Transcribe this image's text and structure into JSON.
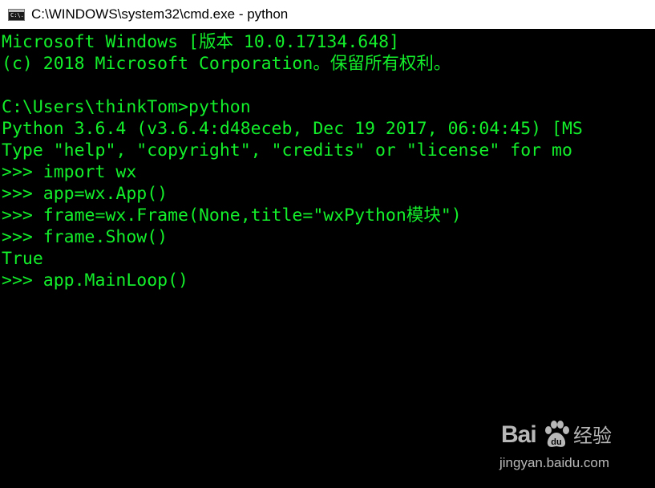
{
  "window": {
    "title": "C:\\WINDOWS\\system32\\cmd.exe - python",
    "icon": "cmd-icon",
    "icon_glyph": "C:\\."
  },
  "colors": {
    "console_background": "#000000",
    "console_text": "#13ef2a",
    "titlebar_background": "#ffffff"
  },
  "console": {
    "lines": [
      "Microsoft Windows [版本 10.0.17134.648]",
      "(c) 2018 Microsoft Corporation。保留所有权利。",
      "",
      "C:\\Users\\thinkTom>python",
      "Python 3.6.4 (v3.6.4:d48eceb, Dec 19 2017, 06:04:45) [MS",
      "Type \"help\", \"copyright\", \"credits\" or \"license\" for mo",
      ">>> import wx",
      ">>> app=wx.App()",
      ">>> frame=wx.Frame(None,title=\"wxPython模块\")",
      ">>> frame.Show()",
      "True",
      ">>> app.MainLoop()"
    ]
  },
  "watermark": {
    "brand": "Bai  ",
    "paw_icon": "baidu-paw-icon",
    "chinese": "经验",
    "url": "jingyan.baidu.com"
  }
}
